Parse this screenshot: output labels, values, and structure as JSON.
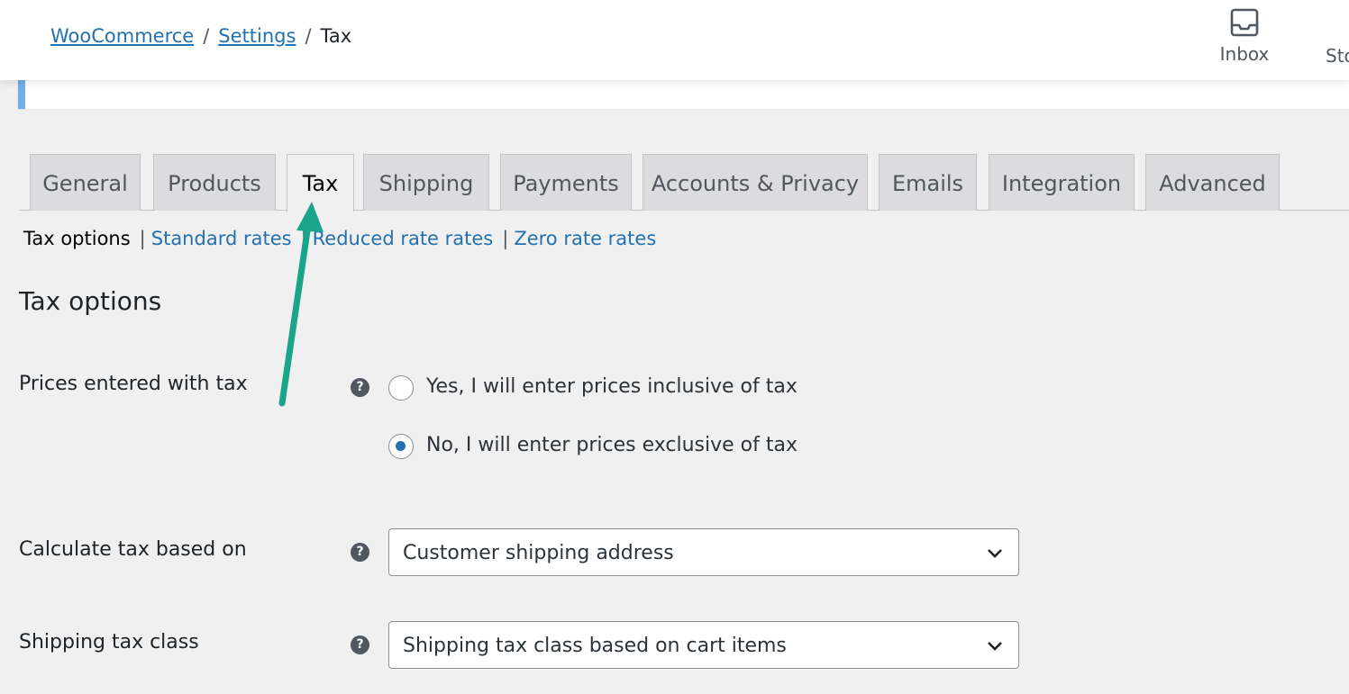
{
  "breadcrumb": {
    "root": "WooCommerce",
    "settings": "Settings",
    "current": "Tax",
    "separator": "/"
  },
  "topbar": {
    "inbox_label": "Inbox",
    "stores_label": "Sto"
  },
  "tabs": [
    {
      "label": "General"
    },
    {
      "label": "Products"
    },
    {
      "label": "Tax"
    },
    {
      "label": "Shipping"
    },
    {
      "label": "Payments"
    },
    {
      "label": "Accounts & Privacy"
    },
    {
      "label": "Emails"
    },
    {
      "label": "Integration"
    },
    {
      "label": "Advanced"
    }
  ],
  "subnav": {
    "current": "Tax options",
    "separator": "|",
    "links": [
      "Standard rates",
      "Reduced rate rates",
      "Zero rate rates"
    ]
  },
  "section": {
    "title": "Tax options"
  },
  "fields": {
    "prices_entered": {
      "label": "Prices entered with tax",
      "help": "?",
      "options": [
        {
          "label": "Yes, I will enter prices inclusive of tax",
          "checked": false
        },
        {
          "label": "No, I will enter prices exclusive of tax",
          "checked": true
        }
      ]
    },
    "calc_based_on": {
      "label": "Calculate tax based on",
      "help": "?",
      "value": "Customer shipping address"
    },
    "shipping_tax_class": {
      "label": "Shipping tax class",
      "help": "?",
      "value": "Shipping tax class based on cart items"
    }
  },
  "colors": {
    "link": "#2271b1",
    "annotation_arrow": "#1aa58a",
    "notice_border": "#72aee6"
  },
  "icons": {
    "inbox": "inbox-icon",
    "help": "help-icon",
    "dropdown": "chevron-down-icon"
  }
}
